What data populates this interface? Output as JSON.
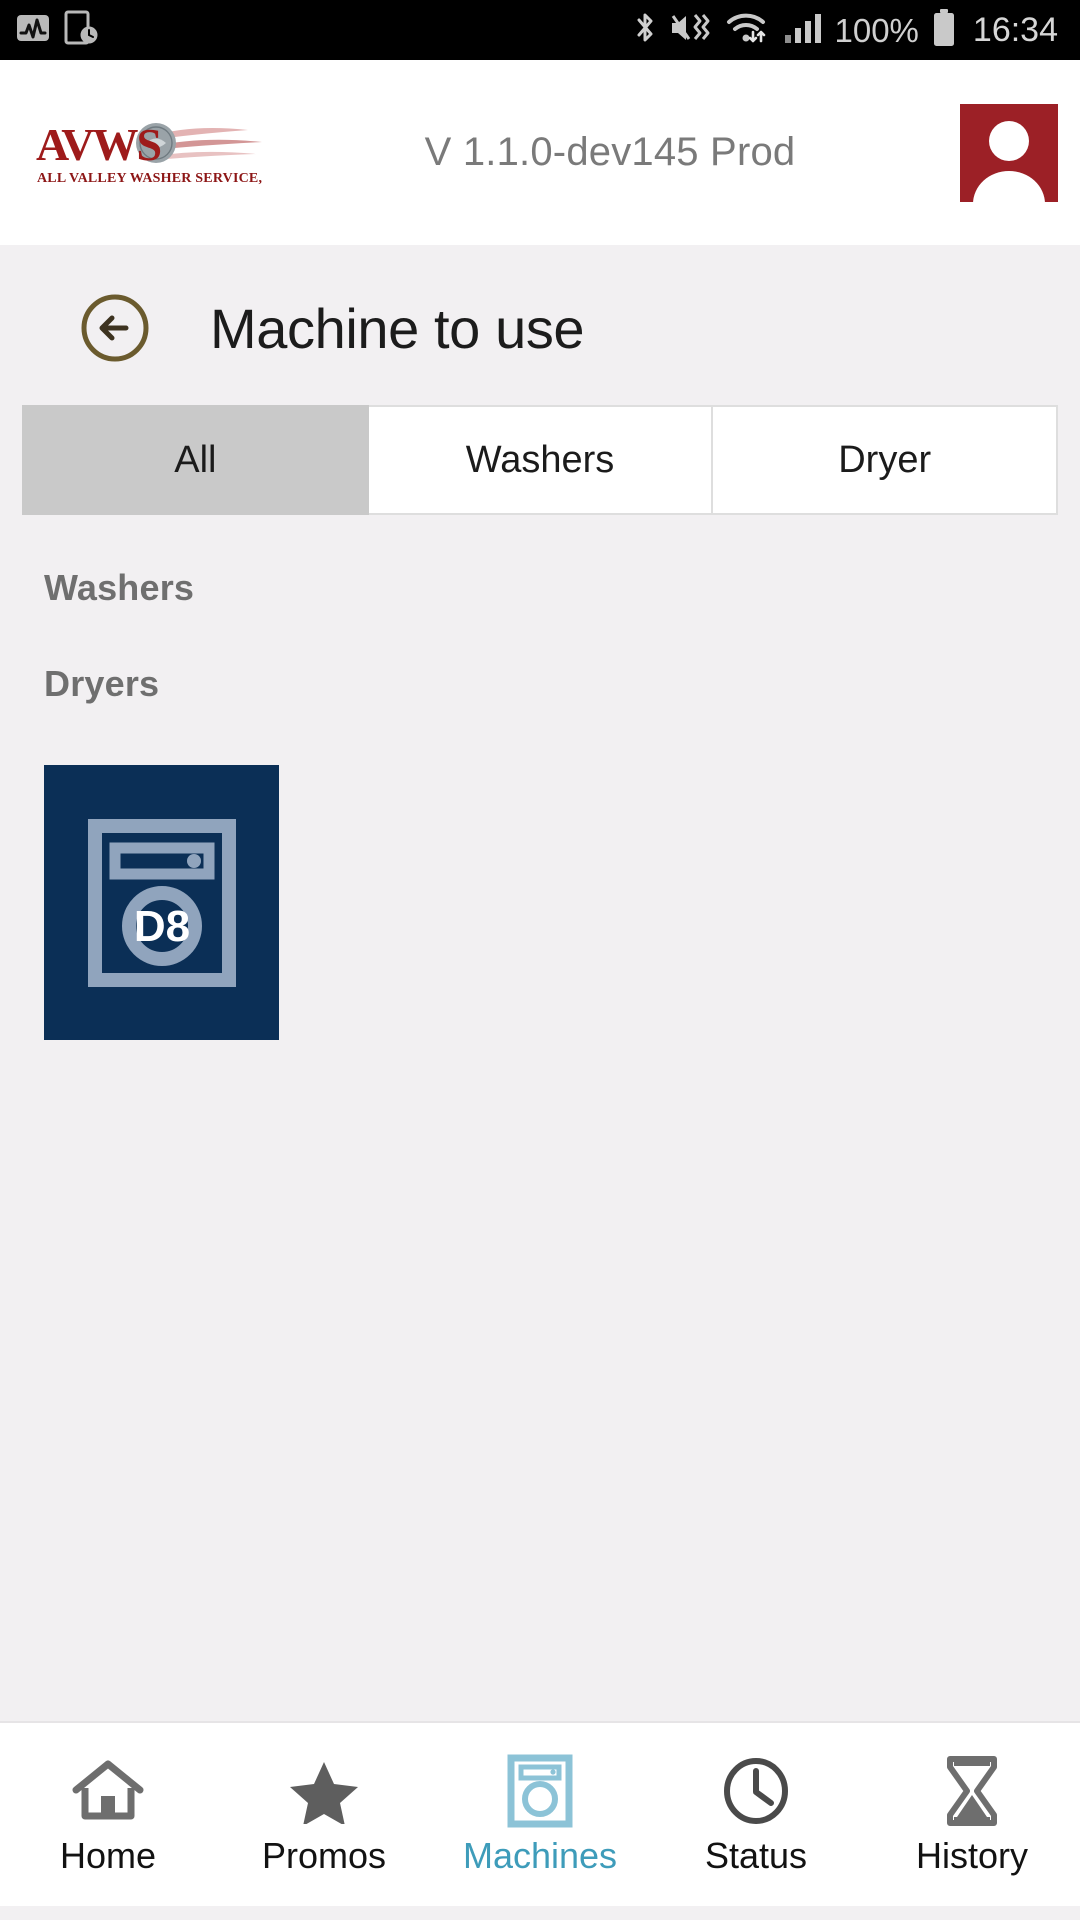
{
  "status_bar": {
    "left_icons": [
      "activity-monitor-icon",
      "device-clock-icon"
    ],
    "right_icons": [
      "bluetooth-icon",
      "mute-vibrate-icon",
      "wifi-icon",
      "cellular-signal-icon"
    ],
    "battery_percent": "100%",
    "battery_icon": "battery-full-icon",
    "time": "16:34"
  },
  "header": {
    "logo_primary": "AVWS",
    "logo_tagline": "ALL VALLEY WASHER SERVICE, INC.",
    "version": "V 1.1.0-dev145 Prod",
    "avatar_icon": "user-avatar-icon",
    "avatar_color": "#9c2026"
  },
  "page": {
    "back_icon": "circle-back-arrow-icon",
    "title": "Machine to use"
  },
  "tabs": {
    "items": [
      {
        "label": "All",
        "selected": true
      },
      {
        "label": "Washers",
        "selected": false
      },
      {
        "label": "Dryer",
        "selected": false
      }
    ]
  },
  "sections": {
    "washers_label": "Washers",
    "dryers_label": "Dryers"
  },
  "machines": {
    "tile_color": "#0b2f56",
    "icon_color": "#90a4bd",
    "items": [
      {
        "id": "D8",
        "type": "dryer",
        "icon": "dryer-machine-icon"
      }
    ]
  },
  "bottom_nav": {
    "active_color": "#3e9cba",
    "items": [
      {
        "label": "Home",
        "icon": "home-icon",
        "active": false
      },
      {
        "label": "Promos",
        "icon": "star-icon",
        "active": false
      },
      {
        "label": "Machines",
        "icon": "washer-icon",
        "active": true
      },
      {
        "label": "Status",
        "icon": "clock-icon",
        "active": false
      },
      {
        "label": "History",
        "icon": "hourglass-icon",
        "active": false
      }
    ]
  }
}
